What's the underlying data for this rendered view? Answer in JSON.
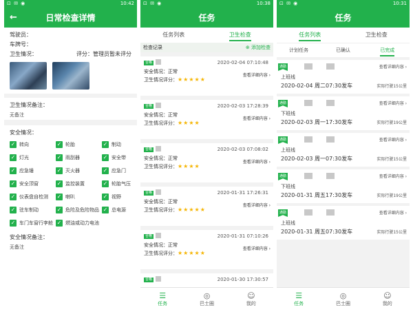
{
  "statusbar": {
    "icons": "⊡ ✉ ◉",
    "p1_time": "10:42",
    "p2_time": "10:38",
    "p3_time": "10:31"
  },
  "panel1": {
    "title": "日常检查详情",
    "back_icon": "←",
    "driver_label": "驾驶员：",
    "vehicle_label": "车牌号：",
    "hygiene_label": "卫生情况：",
    "score_label": "评分：管理员暂未评分",
    "hygiene_note_label": "卫生情况备注：",
    "hygiene_note_value": "无备注",
    "safety_label": "安全情况：",
    "safety_items": [
      "转向",
      "轮胎",
      "制动",
      "灯光",
      "雨刮器",
      "安全带",
      "应急锤",
      "灭火器",
      "应急门",
      "安全顶窗",
      "监控装置",
      "轮胎气压",
      "仪表盘自检测",
      "喇叭",
      "视野",
      "驻车制动",
      "危险及危险物品",
      "总电源",
      "车门车窗行李舱",
      "燃油或动力电池",
      ""
    ],
    "safety_note_label": "安全情况备注：",
    "safety_note_value": "无备注"
  },
  "panel2": {
    "title": "任务",
    "tabs": [
      "任务列表",
      "卫生检查"
    ],
    "active_tab": 1,
    "section_title": "检查记录",
    "add_label": "⊕ 添加检查",
    "safety_label": "安全情况：",
    "hygiene_score_label": "卫生情况评分：",
    "detail_label": "查看详细内容 ›",
    "badge": "合格",
    "records": [
      {
        "date": "2020-02-04 07:10:48",
        "safety": "正常",
        "stars": "★★★★★"
      },
      {
        "date": "2020-02-03 17:28:39",
        "safety": "正常",
        "stars": "★★★★"
      },
      {
        "date": "2020-02-03 07:08:02",
        "safety": "正常",
        "stars": "★★★★"
      },
      {
        "date": "2020-01-31 17:26:31",
        "safety": "正常",
        "stars": "★★★★★"
      },
      {
        "date": "2020-01-31 07:10:26",
        "safety": "正常",
        "stars": "★★★★★"
      },
      {
        "date": "2020-01-30 17:30:57",
        "safety": "",
        "stars": ""
      }
    ],
    "nav": [
      {
        "icon": "☰",
        "label": "任务"
      },
      {
        "icon": "◎",
        "label": "巴士圈"
      },
      {
        "icon": "☺",
        "label": "我的"
      }
    ]
  },
  "panel3": {
    "title": "任务",
    "tabs": [
      "任务列表",
      "卫生检查"
    ],
    "active_tab": 0,
    "subtabs": [
      "计划任务",
      "已确认",
      "已完成"
    ],
    "active_subtab": 2,
    "detail_label": "查看详细内容 ›",
    "flag": "通勤",
    "trips": [
      {
        "line": "上班线",
        "time": "2020-02-04 周二07:30发车",
        "dist": "实际行驶15公里"
      },
      {
        "line": "下班线",
        "time": "2020-02-03 周一17:30发车",
        "dist": "实际行驶19公里"
      },
      {
        "line": "上班线",
        "time": "2020-02-03 周一07:30发车",
        "dist": "实际行驶15公里"
      },
      {
        "line": "下班线",
        "time": "2020-01-31 周五17:30发车",
        "dist": "实际行驶19公里"
      },
      {
        "line": "上班线",
        "time": "2020-01-31 周五07:30发车",
        "dist": "实际行驶15公里"
      }
    ],
    "nav": [
      {
        "icon": "☰",
        "label": "任务"
      },
      {
        "icon": "◎",
        "label": "巴士圈"
      },
      {
        "icon": "☺",
        "label": "我的"
      }
    ]
  },
  "colors": {
    "accent": "#22b14c",
    "star": "#f5b400"
  }
}
